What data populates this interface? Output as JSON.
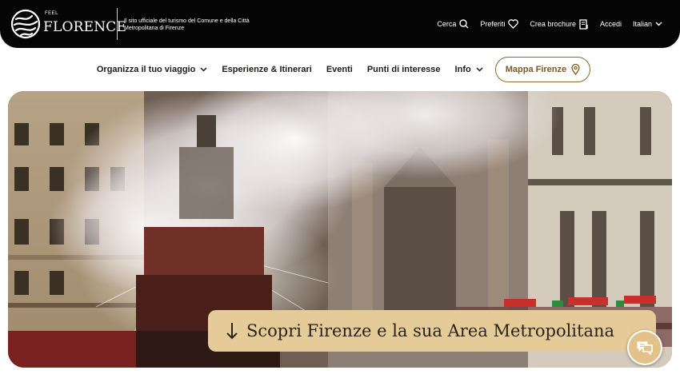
{
  "header": {
    "brand_small": "FEEL",
    "brand_name": "FLORENCE",
    "tagline": "Il sito ufficiale del turismo del Comune e della Città Metropolitana di Firenze",
    "tools": {
      "search": "Cerca",
      "favorites": "Preferiti",
      "brochure": "Crea brochure",
      "login": "Accedi",
      "language": "Italian"
    }
  },
  "nav": {
    "items": [
      "Organizza il tuo viaggio",
      "Esperienze & Itinerari",
      "Eventi",
      "Punti di interesse",
      "Info"
    ],
    "map_button": "Mappa Firenze"
  },
  "hero": {
    "cta_label": "Scopri Firenze e la sua Area Metropolitana"
  },
  "icons": {
    "logo": "feel-florence-logo",
    "search": "search-icon",
    "favorites": "heart-icon",
    "brochure": "brochure-icon",
    "chevron": "chevron-down-icon",
    "map": "map-pin-icon",
    "cta": "arrow-down-icon",
    "chat": "chat-icon"
  },
  "colors": {
    "topbar": "#050505",
    "accent": "#e5cb97",
    "map_button_border": "#8a6a2a"
  }
}
